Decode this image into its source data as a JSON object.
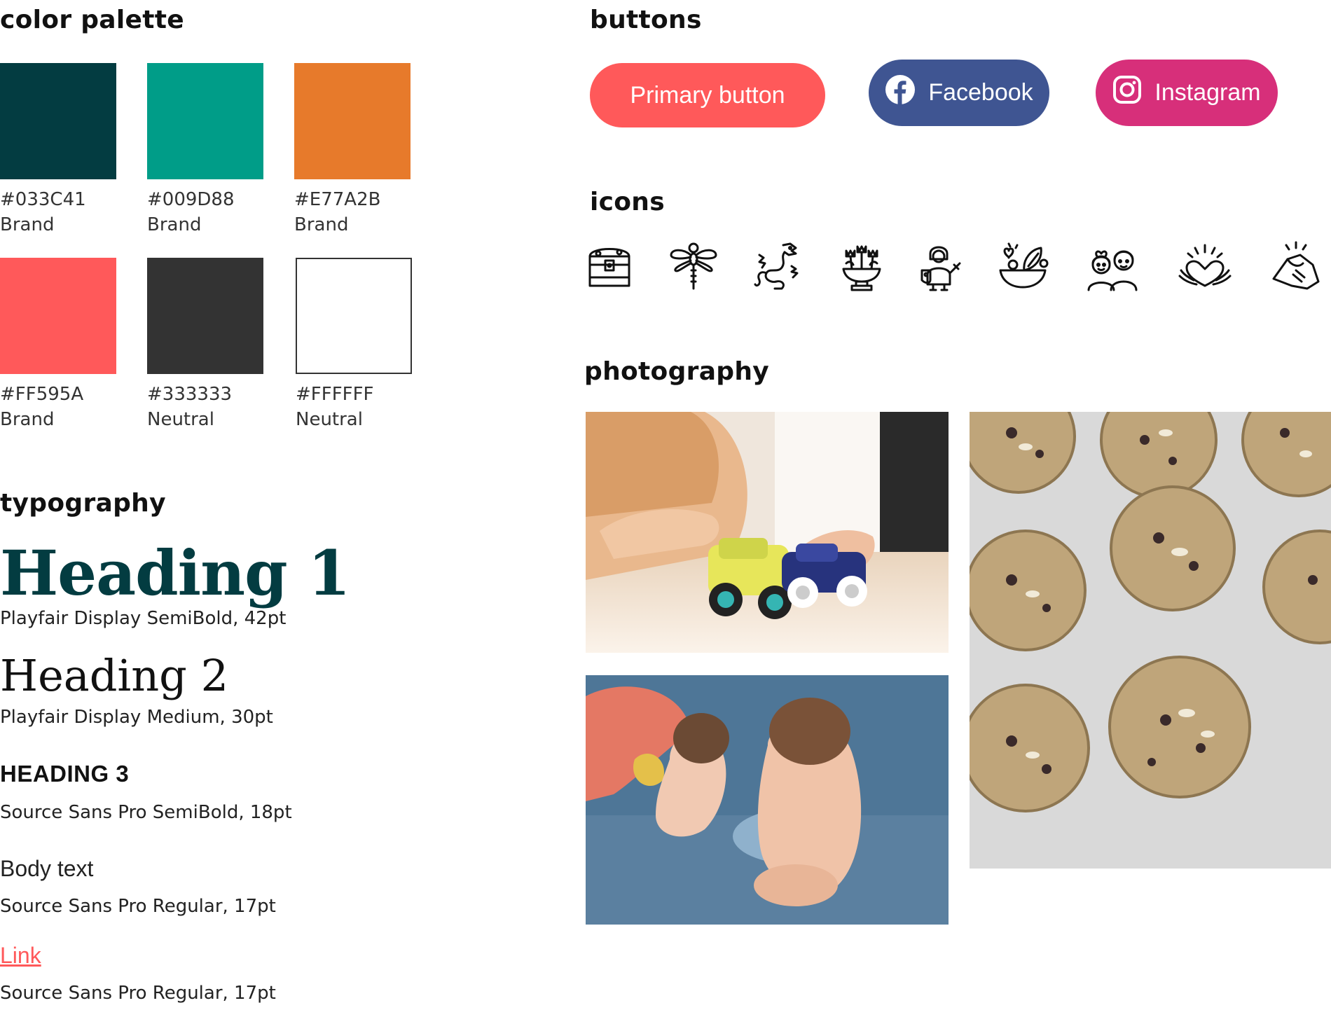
{
  "palette": {
    "title": "color palette",
    "swatches": [
      {
        "hex": "#033C41",
        "kind": "Brand"
      },
      {
        "hex": "#009D88",
        "kind": "Brand"
      },
      {
        "hex": "#E77A2B",
        "kind": "Brand"
      },
      {
        "hex": "#FF595A",
        "kind": "Brand"
      },
      {
        "hex": "#333333",
        "kind": "Neutral"
      },
      {
        "hex": "#FFFFFF",
        "kind": "Neutral"
      }
    ]
  },
  "typography": {
    "title": "typography",
    "h1": {
      "text": "Heading 1",
      "spec": "Playfair Display SemiBold, 42pt"
    },
    "h2": {
      "text": "Heading 2",
      "spec": "Playfair Display Medium, 30pt"
    },
    "h3": {
      "text": "HEADING 3",
      "spec": "Source Sans Pro SemiBold, 18pt"
    },
    "body": {
      "text": "Body text",
      "spec": "Source Sans Pro Regular, 17pt"
    },
    "link": {
      "text": "Link",
      "spec": "Source Sans Pro Regular, 17pt"
    }
  },
  "buttons": {
    "title": "buttons",
    "primary": {
      "label": "Primary button",
      "color": "#FF595A"
    },
    "facebook": {
      "label": "Facebook",
      "color": "#3F5592",
      "icon": "facebook-icon"
    },
    "instagram": {
      "label": "Instagram",
      "color": "#D72F7A",
      "icon": "instagram-icon"
    }
  },
  "icons": {
    "title": "icons",
    "items": [
      "treasure-chest-icon",
      "dragonfly-icon",
      "dragon-icon",
      "flower-pot-icon",
      "knight-icon",
      "salad-bowl-icon",
      "children-icon",
      "heart-hands-icon",
      "handshake-icon"
    ]
  },
  "photography": {
    "title": "photography",
    "items": [
      "photo-child-toy-cars",
      "photo-toddlers-playing",
      "photo-cookies"
    ]
  }
}
